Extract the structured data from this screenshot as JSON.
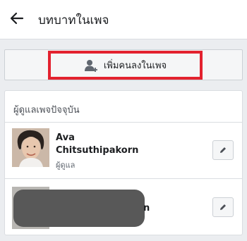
{
  "header": {
    "title": "บทบาทในเพจ",
    "back_icon": "arrow-left-icon"
  },
  "add_person": {
    "label": "เพิ่มคนลงในเพจ",
    "icon": "add-person-icon",
    "highlight_color": "#e3222f"
  },
  "section": {
    "title": "ผู้ดูแลเพจปัจจุบัน"
  },
  "people": [
    {
      "name_line1": "Ava",
      "name_line2": "Chitsuthipakorn",
      "role": "ผู้ดูแล",
      "edit_icon": "pencil-icon"
    },
    {
      "name_visible_tail": "n",
      "edit_icon": "pencil-icon"
    }
  ]
}
